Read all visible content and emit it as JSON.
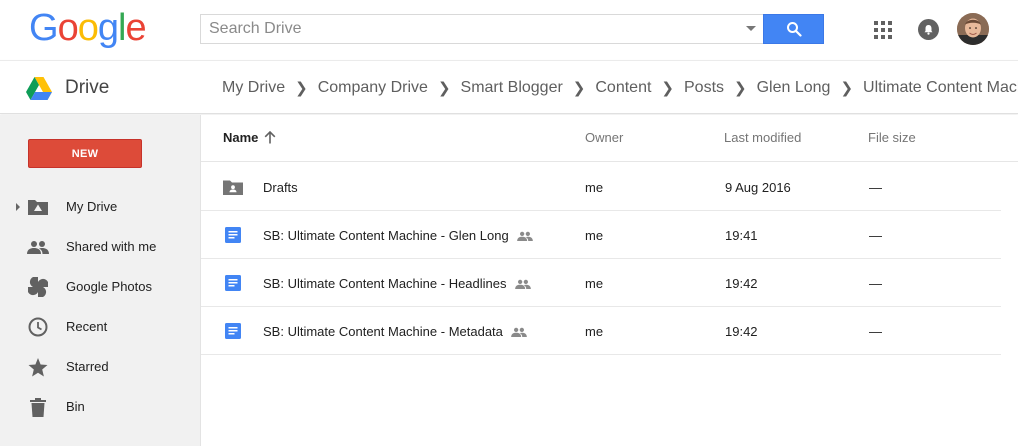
{
  "header": {
    "logo_letters": [
      {
        "ch": "G",
        "color": "#4285f4"
      },
      {
        "ch": "o",
        "color": "#ea4335"
      },
      {
        "ch": "o",
        "color": "#fbbc05"
      },
      {
        "ch": "g",
        "color": "#4285f4"
      },
      {
        "ch": "l",
        "color": "#34a853"
      },
      {
        "ch": "e",
        "color": "#ea4335"
      }
    ],
    "search_placeholder": "Search Drive",
    "search_button_icon": "search-icon",
    "apps_icon": "apps-grid-icon",
    "notifications_icon": "notifications-bell-icon",
    "avatar_icon": "user-avatar"
  },
  "subbar": {
    "product_name": "Drive",
    "breadcrumb": [
      "My Drive",
      "Company Drive",
      "Smart Blogger",
      "Content",
      "Posts",
      "Glen Long",
      "Ultimate Content Machine"
    ]
  },
  "sidebar": {
    "new_label": "NEW",
    "items": [
      {
        "label": "My Drive",
        "icon": "my-drive-icon",
        "expandable": true
      },
      {
        "label": "Shared with me",
        "icon": "shared-people-icon"
      },
      {
        "label": "Google Photos",
        "icon": "google-photos-icon"
      },
      {
        "label": "Recent",
        "icon": "clock-icon"
      },
      {
        "label": "Starred",
        "icon": "star-icon"
      },
      {
        "label": "Bin",
        "icon": "trash-icon"
      }
    ]
  },
  "list": {
    "columns": {
      "name": "Name",
      "owner": "Owner",
      "modified": "Last modified",
      "size": "File size"
    },
    "sort_icon": "arrow-up-icon",
    "rows": [
      {
        "name": "Drafts",
        "type": "shared-folder",
        "shared": false,
        "owner": "me",
        "modified": "9 Aug 2016",
        "size": "—"
      },
      {
        "name": "SB: Ultimate Content Machine - Glen Long",
        "type": "doc",
        "shared": true,
        "owner": "me",
        "modified": "19:41",
        "size": "—"
      },
      {
        "name": "SB: Ultimate Content Machine - Headlines",
        "type": "doc",
        "shared": true,
        "owner": "me",
        "modified": "19:42",
        "size": "—"
      },
      {
        "name": "SB: Ultimate Content Machine - Metadata",
        "type": "doc",
        "shared": true,
        "owner": "me",
        "modified": "19:42",
        "size": "—"
      }
    ]
  },
  "colors": {
    "new_button": "#dd4b39",
    "search_button": "#4285f4",
    "doc_icon": "#4285f4",
    "folder_icon": "#757575",
    "sidebar_bg": "#f1f1f1"
  }
}
